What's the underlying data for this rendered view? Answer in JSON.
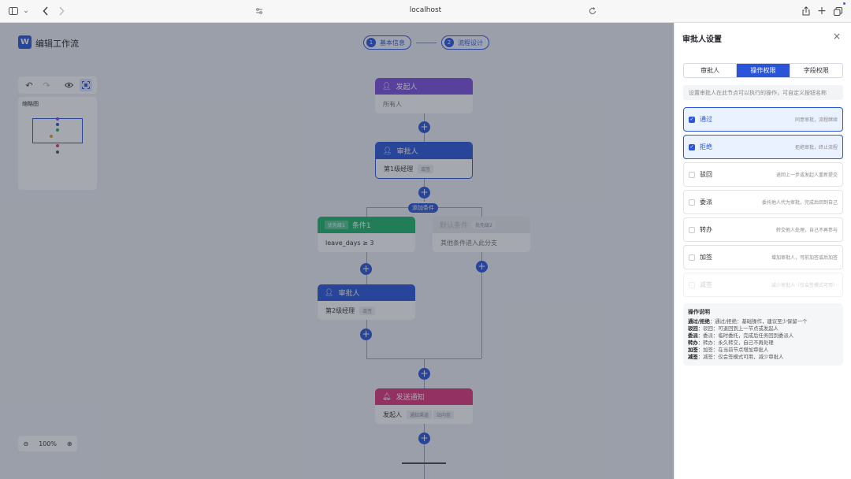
{
  "browser": {
    "url": "localhost",
    "icons": [
      "sidebar-icon",
      "chevron-down-icon",
      "back-icon",
      "forward-icon",
      "site-settings-icon",
      "reload-icon",
      "share-icon",
      "new-tab-icon",
      "tabs-icon"
    ]
  },
  "app": {
    "logo": "W",
    "title": "编辑工作流",
    "steps": [
      {
        "num": "1",
        "label": "基本信息"
      },
      {
        "num": "2",
        "label": "流程设计"
      }
    ]
  },
  "canvas": {
    "minimap_title": "缩略图",
    "zoom_level": "100%",
    "nodes": {
      "start": {
        "title": "发起人",
        "body": "所有人"
      },
      "approver1": {
        "title": "审批人",
        "body": "第1级经理",
        "tag": "或签"
      },
      "add_condition": "添加条件",
      "cond1": {
        "priority": "优先级1",
        "title": "条件1",
        "body": "leave_days ≥ 3"
      },
      "cond2": {
        "title": "默认条件",
        "priority": "优先级2",
        "body": "其他条件进入此分支"
      },
      "approver2": {
        "title": "审批人",
        "body": "第2级经理",
        "tag": "或签"
      },
      "notify": {
        "title": "发送通知",
        "body": "发起人",
        "tags": [
          "通知渠道",
          "站内信"
        ]
      }
    },
    "add_symbol": "+"
  },
  "panel": {
    "title": "审批人设置",
    "close": "×",
    "tabs": [
      "审批人",
      "操作权限",
      "字段权限"
    ],
    "active_tab": 1,
    "hint": "设置审批人在此节点可以执行的操作，可自定义按钮名称",
    "permissions": [
      {
        "name": "通过",
        "desc": "同意审批，流程继续",
        "checked": true,
        "disabled": false
      },
      {
        "name": "拒绝",
        "desc": "拒绝审批，终止流程",
        "checked": true,
        "disabled": false
      },
      {
        "name": "驳回",
        "desc": "退回上一步或发起人重新提交",
        "checked": false,
        "disabled": false
      },
      {
        "name": "委派",
        "desc": "委托他人代为审批，完成后回到自己",
        "checked": false,
        "disabled": false
      },
      {
        "name": "转办",
        "desc": "转交他人处理，自己不再参与",
        "checked": false,
        "disabled": false
      },
      {
        "name": "加签",
        "desc": "增加审批人，可前加签或后加签",
        "checked": false,
        "disabled": false
      },
      {
        "name": "减签",
        "desc": "减少审批人（仅会签模式可用）",
        "checked": false,
        "disabled": true
      }
    ],
    "notes_title": "操作说明",
    "notes": [
      {
        "key": "通过/拒绝",
        "text": "：通过/拒绝：基础操作，建议至少保留一个"
      },
      {
        "key": "驳回",
        "text": "：驳回：可退回到上一节点或发起人"
      },
      {
        "key": "委派",
        "text": "：委派：临时委托，完成后任务回到委派人"
      },
      {
        "key": "转办",
        "text": "：转办：永久转交，自己不再处理"
      },
      {
        "key": "加签",
        "text": "：加签：在当前节点增加审批人"
      },
      {
        "key": "减签",
        "text": "：减签：仅会签模式可用，减少审批人"
      }
    ]
  }
}
